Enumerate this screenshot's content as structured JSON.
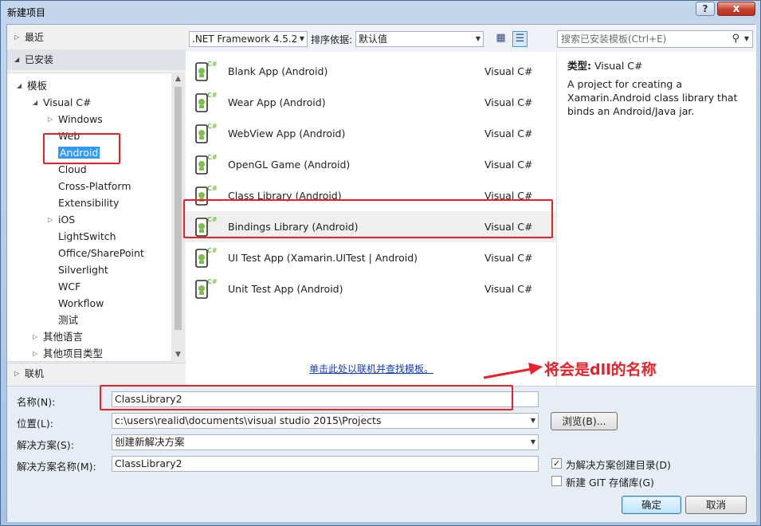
{
  "window": {
    "title": "新建项目",
    "help": "?",
    "close": "x"
  },
  "left": {
    "recent": "最近",
    "installed": "已安装",
    "online": "联机",
    "tree": [
      {
        "label": "模板",
        "level": 0,
        "arrow": "◢",
        "name": "tree-item-templates"
      },
      {
        "label": "Visual C#",
        "level": 1,
        "arrow": "◢",
        "name": "tree-item-visual-csharp"
      },
      {
        "label": "Windows",
        "level": 2,
        "arrow": "▷",
        "name": "tree-item-windows"
      },
      {
        "label": "Web",
        "level": 2,
        "arrow": "",
        "name": "tree-item-web"
      },
      {
        "label": "Android",
        "level": 2,
        "arrow": "",
        "name": "tree-item-android",
        "selected": true
      },
      {
        "label": "Cloud",
        "level": 2,
        "arrow": "",
        "name": "tree-item-cloud"
      },
      {
        "label": "Cross-Platform",
        "level": 2,
        "arrow": "",
        "name": "tree-item-cross-platform"
      },
      {
        "label": "Extensibility",
        "level": 2,
        "arrow": "",
        "name": "tree-item-extensibility"
      },
      {
        "label": "iOS",
        "level": 2,
        "arrow": "▷",
        "name": "tree-item-ios"
      },
      {
        "label": "LightSwitch",
        "level": 2,
        "arrow": "",
        "name": "tree-item-lightswitch"
      },
      {
        "label": "Office/SharePoint",
        "level": 2,
        "arrow": "",
        "name": "tree-item-office-sharepoint"
      },
      {
        "label": "Silverlight",
        "level": 2,
        "arrow": "",
        "name": "tree-item-silverlight"
      },
      {
        "label": "WCF",
        "level": 2,
        "arrow": "",
        "name": "tree-item-wcf"
      },
      {
        "label": "Workflow",
        "level": 2,
        "arrow": "",
        "name": "tree-item-workflow"
      },
      {
        "label": "测试",
        "level": 2,
        "arrow": "",
        "name": "tree-item-test"
      },
      {
        "label": "其他语言",
        "level": 1,
        "arrow": "▷",
        "name": "tree-item-other-languages"
      },
      {
        "label": "其他项目类型",
        "level": 1,
        "arrow": "▷",
        "name": "tree-item-other-project-types"
      }
    ]
  },
  "toolbar": {
    "framework": ".NET Framework 4.5.2",
    "sort_label": "排序依据:",
    "sort_value": "默认值",
    "search_placeholder": "搜索已安装模板(Ctrl+E)"
  },
  "templates": [
    {
      "name": "Blank App (Android)",
      "lang": "Visual C#"
    },
    {
      "name": "Wear App (Android)",
      "lang": "Visual C#"
    },
    {
      "name": "WebView App (Android)",
      "lang": "Visual C#"
    },
    {
      "name": "OpenGL Game (Android)",
      "lang": "Visual C#"
    },
    {
      "name": "Class Library (Android)",
      "lang": "Visual C#"
    },
    {
      "name": "Bindings Library (Android)",
      "lang": "Visual C#",
      "selected": true
    },
    {
      "name": "UI Test App (Xamarin.UITest | Android)",
      "lang": "Visual C#"
    },
    {
      "name": "Unit Test App (Android)",
      "lang": "Visual C#"
    }
  ],
  "online_link": "单击此处以联机并查找模板。",
  "details": {
    "type_label": "类型:",
    "type_value": "Visual C#",
    "description": "A project for creating a Xamarin.Android class library that binds an Android/Java jar."
  },
  "form": {
    "name_label": "名称(N):",
    "name_value": "ClassLibrary2",
    "location_label": "位置(L):",
    "location_value": "c:\\users\\realid\\documents\\visual studio 2015\\Projects",
    "solution_label": "解决方案(S):",
    "solution_value": "创建新解决方案",
    "solution_name_label": "解决方案名称(M):",
    "solution_name_value": "ClassLibrary2",
    "browse": "浏览(B)...",
    "create_dir": "为解决方案创建目录(D)",
    "create_dir_checked": true,
    "new_git": "新建 GIT 存储库(G)",
    "new_git_checked": false,
    "ok": "确定",
    "cancel": "取消"
  },
  "annotation": {
    "text": "将会是dll的名称",
    "color": "#e8212a"
  }
}
